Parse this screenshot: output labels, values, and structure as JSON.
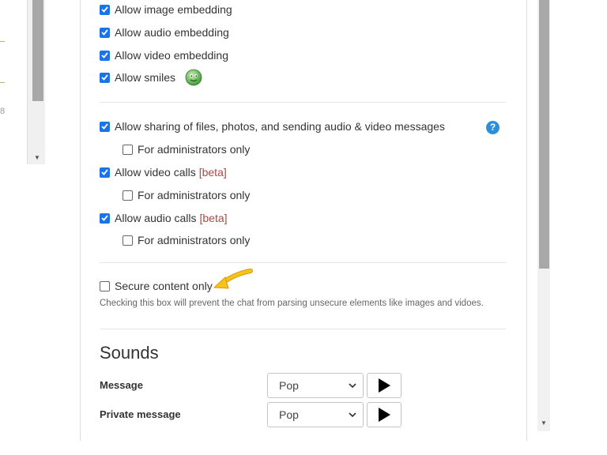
{
  "background": {
    "glyph": "8"
  },
  "settings": {
    "embedding": [
      {
        "label": "Allow image embedding",
        "checked": true
      },
      {
        "label": "Allow audio embedding",
        "checked": true
      },
      {
        "label": "Allow video embedding",
        "checked": true
      },
      {
        "label": "Allow smiles",
        "checked": true
      }
    ],
    "sharing": {
      "label": "Allow sharing of files, photos, and sending audio & video messages",
      "checked": true,
      "admin_label": "For administrators only",
      "admin_checked": false,
      "help_icon": "?"
    },
    "video_calls": {
      "label": "Allow video calls",
      "beta": "[beta]",
      "checked": true,
      "admin_label": "For administrators only",
      "admin_checked": false
    },
    "audio_calls": {
      "label": "Allow audio calls",
      "beta": "[beta]",
      "checked": true,
      "admin_label": "For administrators only",
      "admin_checked": false
    },
    "secure": {
      "label": "Secure content only",
      "checked": false,
      "note": "Checking this box will prevent the chat from parsing unsecure elements like images and vidoes."
    }
  },
  "sounds": {
    "title": "Sounds",
    "rows": [
      {
        "label": "Message",
        "value": "Pop"
      },
      {
        "label": "Private message",
        "value": "Pop"
      }
    ]
  },
  "colors": {
    "checkbox": "#1a73e8",
    "help": "#2d8fd8",
    "beta": "#b34444",
    "arrow": "#f2b705"
  }
}
